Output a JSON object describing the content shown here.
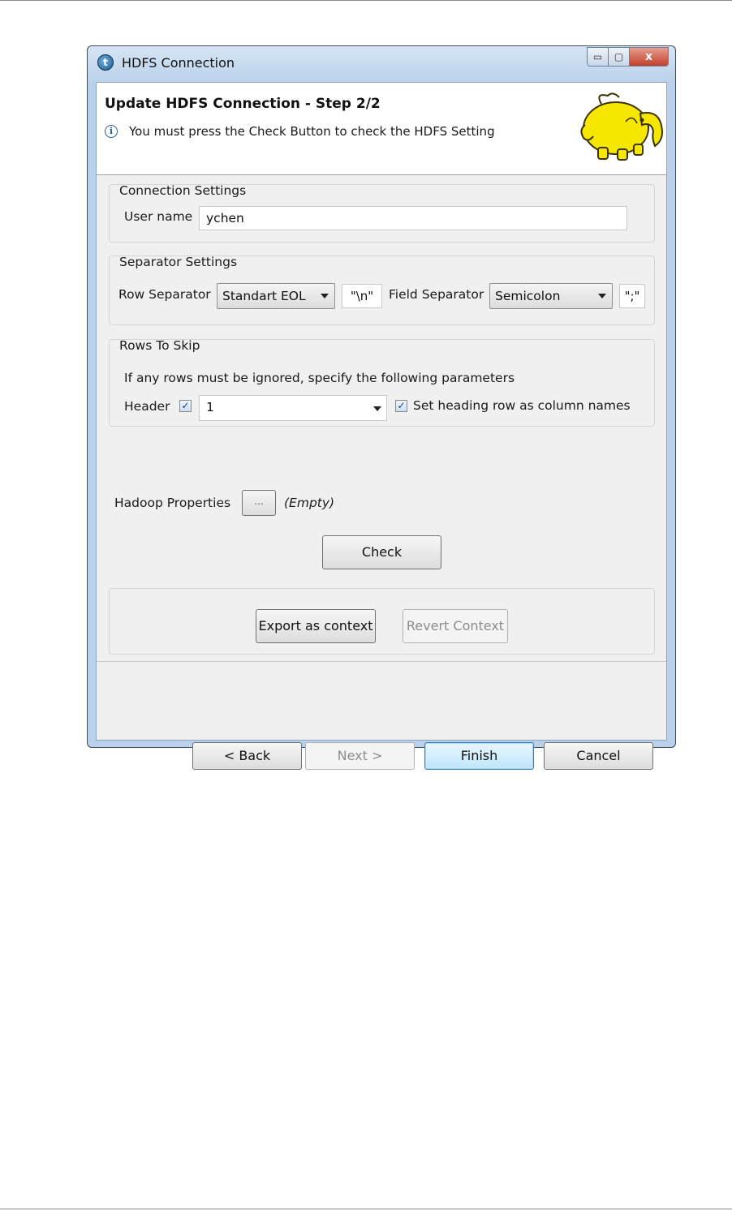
{
  "window": {
    "title": "HDFS Connection",
    "app_icon": "talend-logo-icon",
    "close_glyph": "x",
    "maximize_glyph": "▢",
    "minimize_glyph": "▭"
  },
  "banner": {
    "title": "Update HDFS Connection - Step 2/2",
    "message": "You must press the Check Button to check the HDFS Setting",
    "info_glyph": "i",
    "image": "hadoop-elephant-logo"
  },
  "connection": {
    "group_title": "Connection Settings",
    "user_label": "User name",
    "user_value": "ychen"
  },
  "separator": {
    "group_title": "Separator Settings",
    "row_label": "Row Separator",
    "row_value": "Standart EOL",
    "row_char": "\"\\n\"",
    "field_label": "Field Separator",
    "field_value": "Semicolon",
    "field_char": "\";\""
  },
  "skip": {
    "group_title": "Rows To Skip",
    "description": "If any rows must be ignored, specify the following parameters",
    "header_label": "Header",
    "header_checked": true,
    "header_value": "1",
    "heading_label": "Set heading row as column names",
    "heading_checked": true
  },
  "hadoop": {
    "label": "Hadoop Properties",
    "button": "...",
    "value": "(Empty)"
  },
  "check_button": "Check",
  "context": {
    "export": "Export as context",
    "revert": "Revert Context"
  },
  "footer": {
    "back": "< Back",
    "next": "Next >",
    "finish": "Finish",
    "cancel": "Cancel"
  },
  "colors": {
    "accent": "#3c7fb1",
    "titlebar": "#c9dcef",
    "close": "#c2402b",
    "elephant": "#f6e700"
  }
}
